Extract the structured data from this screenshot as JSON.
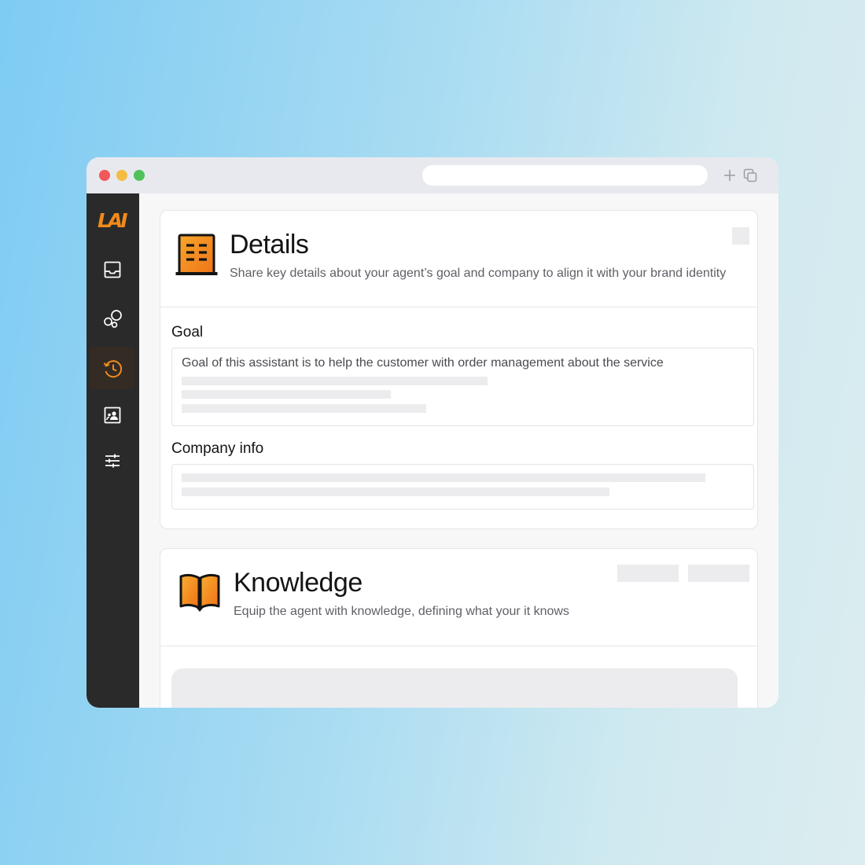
{
  "app": {
    "logo_text": "LAI",
    "accent_color": "#f08a1c"
  },
  "window": {
    "traffic_lights": [
      "close",
      "minimize",
      "zoom"
    ],
    "toolbar_icons": [
      "plus-icon",
      "copy-icon"
    ]
  },
  "sidebar": {
    "items": [
      {
        "icon": "inbox-icon",
        "active": false
      },
      {
        "icon": "bubbles-icon",
        "active": false
      },
      {
        "icon": "history-icon",
        "active": true
      },
      {
        "icon": "contacts-icon",
        "active": false
      },
      {
        "icon": "sliders-icon",
        "active": false
      }
    ]
  },
  "details": {
    "icon": "building-icon",
    "title": "Details",
    "subtitle": "Share key details about your agent’s goal and company to align it with your brand identity",
    "goal": {
      "label": "Goal",
      "value": "Goal of this assistant is to help the customer with order management about the service"
    },
    "company": {
      "label": "Company info"
    }
  },
  "knowledge": {
    "icon": "open-book-icon",
    "title": "Knowledge",
    "subtitle": "Equip the agent with knowledge, defining what your it knows"
  }
}
